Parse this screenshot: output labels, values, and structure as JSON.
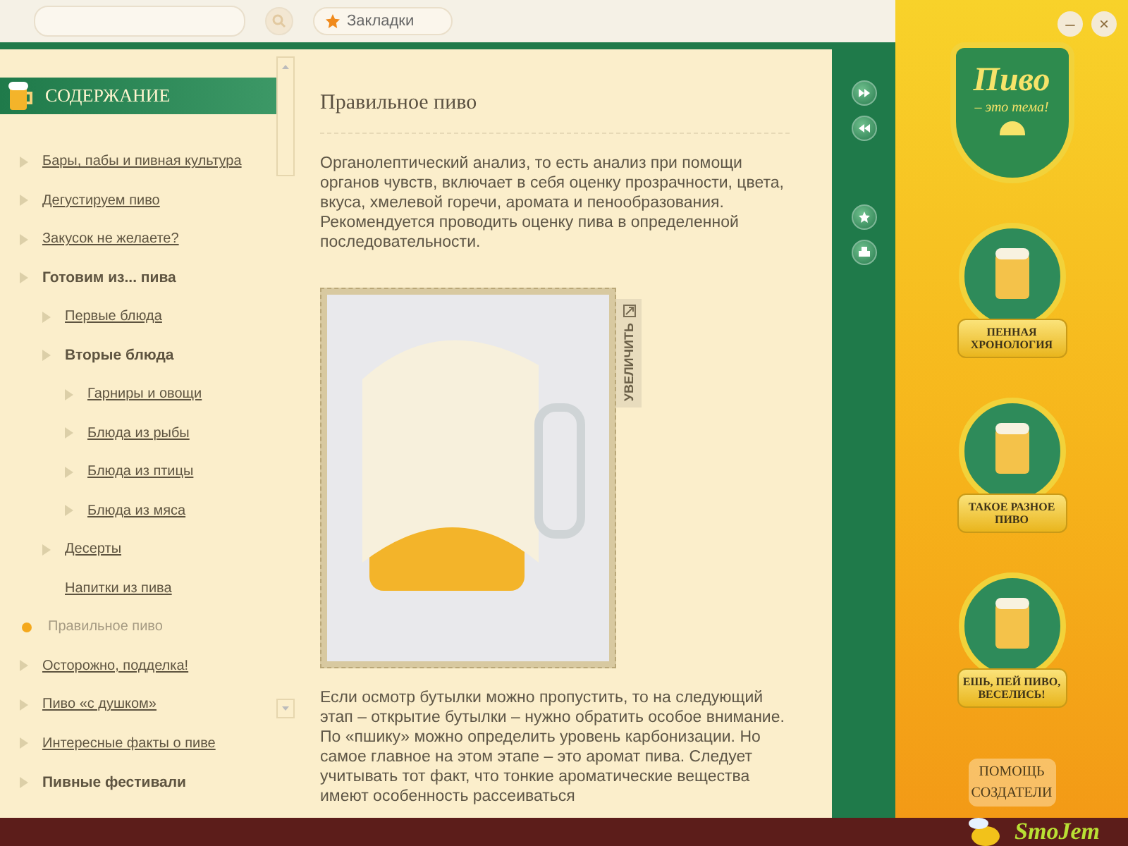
{
  "topbar": {
    "bookmarks_label": "Закладки"
  },
  "window_buttons": [
    "–",
    "×"
  ],
  "sidebar": {
    "title": "СОДЕРЖАНИЕ",
    "items": [
      {
        "label": "Бары, пабы и пивная культура",
        "arrow": true,
        "expanded": false,
        "selected": false
      },
      {
        "label": "Дегустируем пиво",
        "arrow": true,
        "expanded": false,
        "selected": false
      },
      {
        "label": "Закусок не желаете?",
        "arrow": true,
        "expanded": false,
        "selected": false
      },
      {
        "label": "Готовим из... пива",
        "arrow": true,
        "expanded": true,
        "selected": false,
        "children": [
          {
            "label": "Первые блюда",
            "arrow": true,
            "expanded": false,
            "selected": false
          },
          {
            "label": "Вторые блюда",
            "arrow": true,
            "expanded": true,
            "selected": false,
            "children": [
              {
                "label": "Гарниры и овощи",
                "arrow": true,
                "expanded": false,
                "selected": false
              },
              {
                "label": "Блюда из рыбы",
                "arrow": true,
                "expanded": false,
                "selected": false
              },
              {
                "label": "Блюда из птицы",
                "arrow": true,
                "expanded": false,
                "selected": false
              },
              {
                "label": "Блюда из мяса",
                "arrow": true,
                "expanded": false,
                "selected": false
              }
            ]
          },
          {
            "label": "Десерты",
            "arrow": true,
            "expanded": false,
            "selected": false
          },
          {
            "label": "Напитки из пива",
            "arrow": false,
            "expanded": false,
            "selected": false
          }
        ]
      },
      {
        "label": "Правильное пиво",
        "expanded": false,
        "selected": true
      },
      {
        "label": "Осторожно, подделка!",
        "arrow": true,
        "expanded": false,
        "selected": false
      },
      {
        "label": "Пиво «с душком»",
        "arrow": true,
        "expanded": false,
        "selected": false
      },
      {
        "label": "Интересные факты о пиве",
        "arrow": true,
        "expanded": false,
        "selected": false
      },
      {
        "label": "Пивные фестивали",
        "arrow": true,
        "expanded": true,
        "selected": false
      }
    ]
  },
  "article": {
    "title": "Правильное пиво",
    "paragraphs": [
      "Органолептический анализ, то есть анализ при помощи органов чувств, включает в себя оценку прозрачности, цвета, вкуса, хмелевой горечи, аромата и пенообразования. Рекомендуется проводить оценку пива в определенной последовательности.",
      "Если осмотр бутылки можно пропустить, то на следующий этап – открытие бутылки – нужно обратить особое внимание. По «пшику» можно определить уровень карбонизации. Но самое главное на этом этапе – это аромат пива. Следует учитывать тот факт, что тонкие ароматические вещества имеют особенность рассеиваться"
    ],
    "zoom_label": "УВЕЛИЧИТЬ"
  },
  "logo": {
    "title": "Пиво",
    "subtitle": "– это тема!"
  },
  "sections": [
    {
      "label": "ПЕННАЯ ХРОНОЛОГИЯ"
    },
    {
      "label": "ТАКОЕ РАЗНОЕ ПИВО"
    },
    {
      "label": "ЕШЬ, ПЕЙ ПИВО, ВЕСЕЛИСЬ!"
    }
  ],
  "help_links": [
    "ПОМОЩЬ",
    "СОЗДАТЕЛИ"
  ],
  "brand": "SmoJem"
}
